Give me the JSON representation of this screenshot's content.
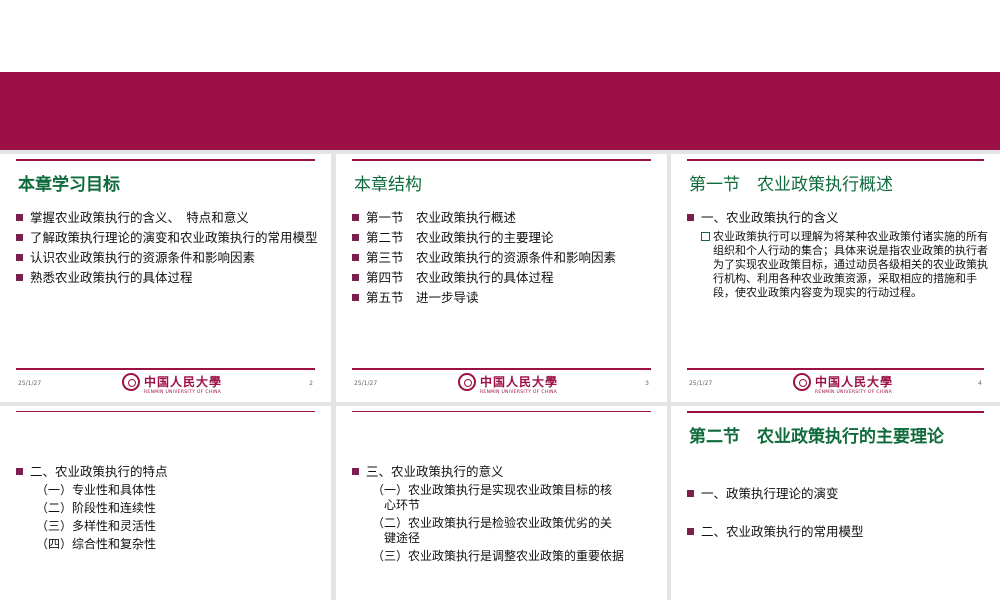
{
  "colors": {
    "banner": "#9c1046",
    "title_green": "#0f6b3c",
    "bullet": "#7b1f4e"
  },
  "footer": {
    "date": "25/1/27",
    "logo_name": "中国人民大學",
    "logo_sub": "RENMIN UNIVERSITY OF CHINA"
  },
  "slides": [
    {
      "title": "本章学习目标",
      "page": "2",
      "bullets": [
        "掌握农业政策执行的含义、　特点和意义",
        "了解政策执行理论的演变和农业政策执行的常用模型",
        "认识农业政策执行的资源条件和影响因素",
        "熟悉农业政策执行的具体过程"
      ]
    },
    {
      "title": "本章结构",
      "page": "3",
      "bullets": [
        "第一节　农业政策执行概述",
        "第二节　农业政策执行的主要理论",
        "第三节　农业政策执行的资源条件和影响因素",
        "第四节　农业政策执行的具体过程",
        "第五节　进一步导读"
      ]
    },
    {
      "title": "第一节　农业政策执行概述",
      "page": "4",
      "bullets": [
        "一、农业政策执行的含义"
      ],
      "sub_bullet": "农业政策执行可以理解为将某种农业政策付诸实施的所有组织和个人行动的集合；具体来说是指农业政策的执行者为了实现农业政策目标，通过动员各级相关的农业政策执行机构、利用各种农业政策资源，采取相应的措施和手段，使农业政策内容变为现实的行动过程。"
    },
    {
      "bullets": [
        "二、农业政策执行的特点"
      ],
      "items": [
        "（一）专业性和具体性",
        "（二）阶段性和连续性",
        "（三）多样性和灵活性",
        "（四）综合性和复杂性"
      ]
    },
    {
      "bullets": [
        "三、农业政策执行的意义"
      ],
      "items": [
        "（一）农业政策执行是实现农业政策目标的核心环节",
        "（二）农业政策执行是检验农业政策优劣的关键途径",
        "（三）农业政策执行是调整农业政策的重要依据"
      ]
    },
    {
      "title": "第二节　农业政策执行的主要理论",
      "bullets": [
        "一、政策执行理论的演变",
        "二、农业政策执行的常用模型"
      ]
    }
  ]
}
